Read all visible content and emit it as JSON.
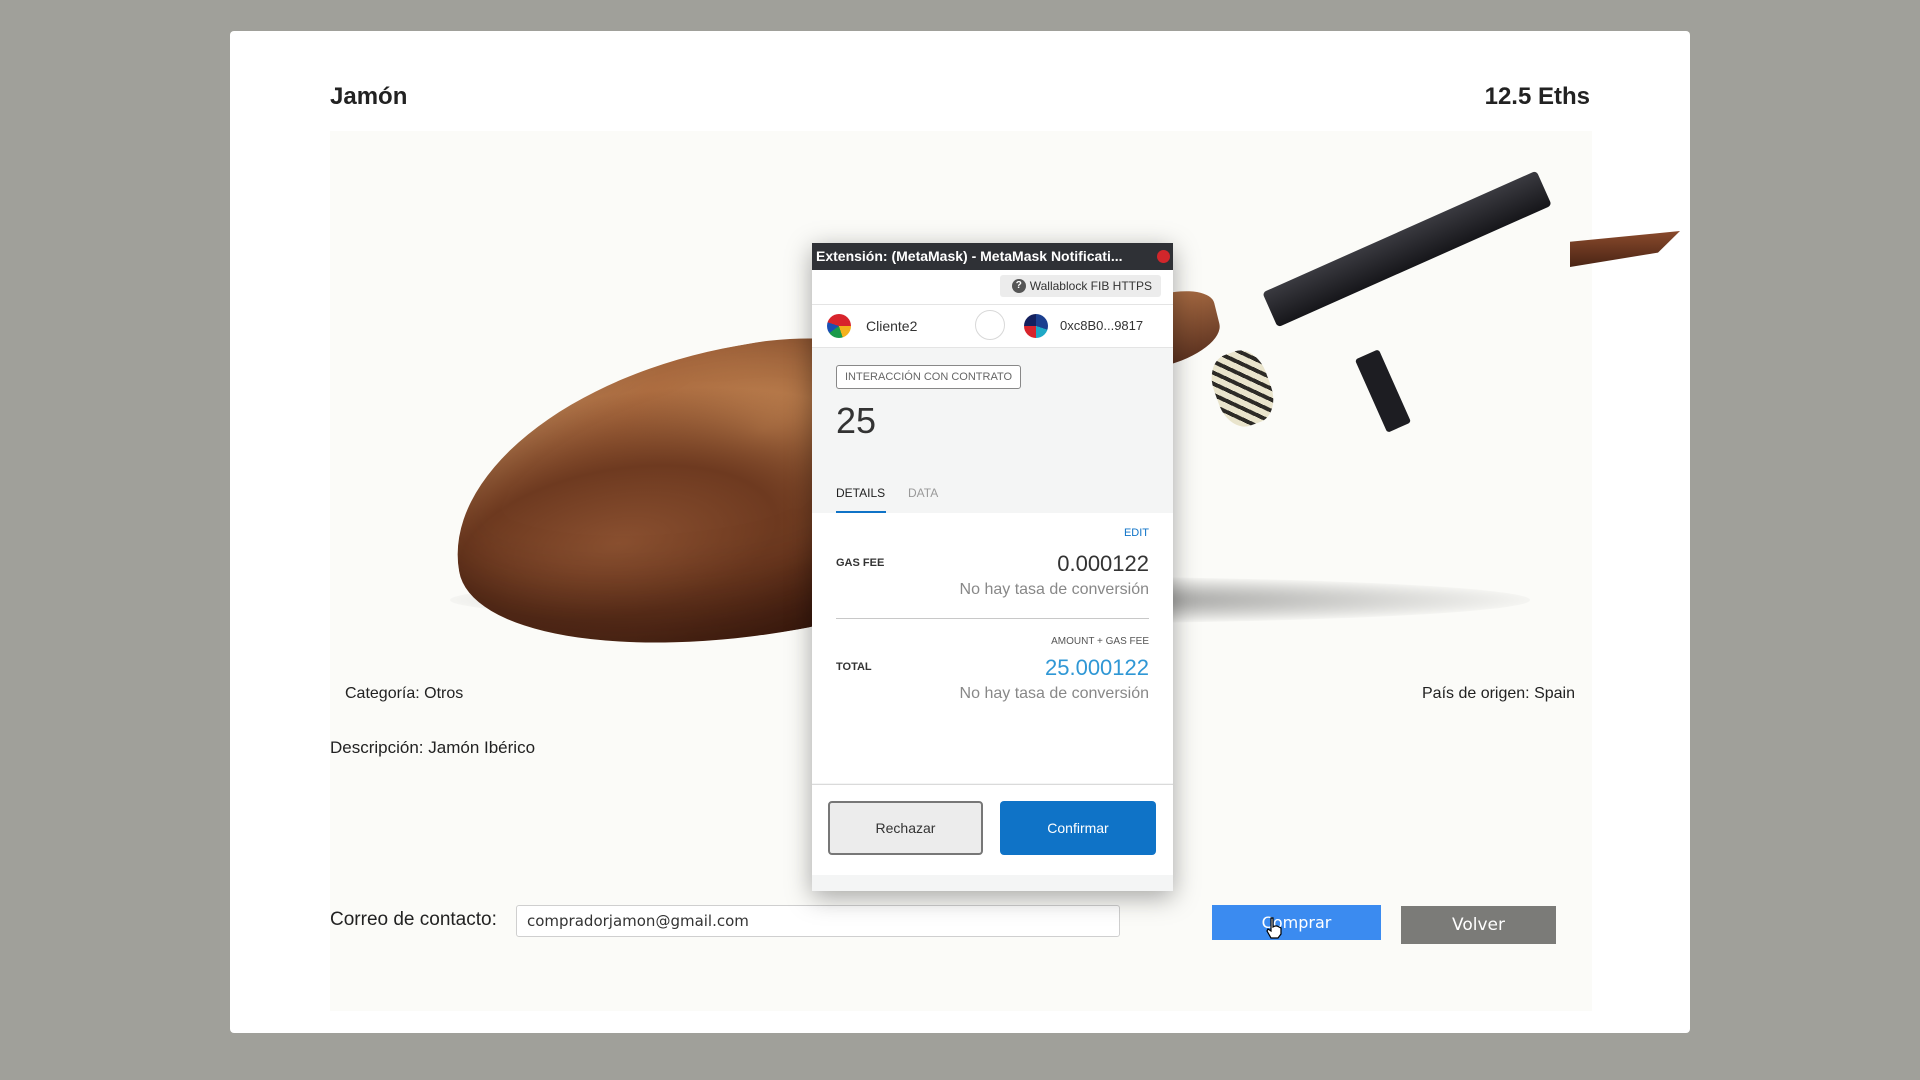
{
  "product": {
    "title": "Jamón",
    "price": "12.5 Eths",
    "category": "Categoría: Otros",
    "origin": "País de origen: Spain",
    "description": "Descripción: Jamón Ibérico"
  },
  "contact": {
    "label": "Correo de contacto:",
    "email_value": "compradorjamon@gmail.com"
  },
  "actions": {
    "buy_label": "Comprar",
    "back_label": "Volver"
  },
  "metamask": {
    "window_title": "Extensión: (MetaMask) - MetaMask Notificati...",
    "network": "Wallablock FIB HTTPS",
    "from_account": "Cliente2",
    "to_address": "0xc8B0...9817",
    "badge": "INTERACCIÓN CON CONTRATO",
    "amount": "25",
    "tabs": [
      {
        "label": "DETAILS",
        "active": true
      },
      {
        "label": "DATA",
        "active": false
      }
    ],
    "edit_label": "EDIT",
    "gas_fee_label": "GAS FEE",
    "gas_fee_value": "0.000122",
    "gas_fee_conversion": "No hay tasa de conversión",
    "amount_gas_label": "AMOUNT + GAS FEE",
    "total_label": "TOTAL",
    "total_value": "25.000122",
    "total_conversion": "No hay tasa de conversión",
    "reject_label": "Rechazar",
    "confirm_label": "Confirmar"
  },
  "colors": {
    "backdrop": "#a0a09a",
    "buy_button": "#3b8bf0",
    "back_button": "#7b7b78",
    "mm_primary": "#0f73c7",
    "mm_total": "#2f97d5"
  },
  "icons": [
    "help-icon",
    "from-account-avatar",
    "to-account-avatar",
    "arrow-circle-icon",
    "close-icon",
    "hand-cursor-icon"
  ]
}
